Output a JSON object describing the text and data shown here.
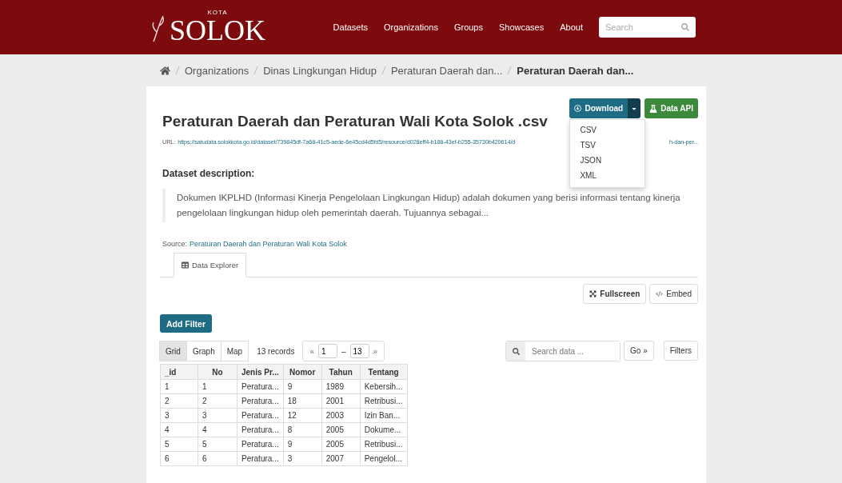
{
  "header": {
    "logo": {
      "small": "KOTA",
      "big": "SOLOK"
    },
    "nav": [
      "Datasets",
      "Organizations",
      "Groups",
      "Showcases",
      "About"
    ],
    "search": {
      "placeholder": "Search"
    }
  },
  "breadcrumb": {
    "items": [
      "Organizations",
      "Dinas Lingkungan Hidup",
      "Peraturan Daerah dan..."
    ],
    "current": "Peraturan Daerah dan..."
  },
  "resource": {
    "title": "Peraturan Daerah dan Peraturan Wali Kota Solok .csv",
    "download": {
      "label": "Download",
      "expanded": true,
      "options": [
        "CSV",
        "TSV",
        "JSON",
        "XML"
      ]
    },
    "data_api": "Data API",
    "url": {
      "label": "URL:",
      "start": "https://satudata.solokkota.go.id/dataset/739845df-7a68-41c5-aede-6e45cd4d5fd5/resource/d028eff4-b188-43ef-b255-35730b420614/d",
      "end": "h-dan-per..."
    },
    "description_heading": "Dataset description:",
    "description": "Dokumen IKPLHD (Informasi Kinerja Pengelolaan Lingkungan Hidup) adalah dokumen yang berisi informasi tentang kinerja pengelolaan lingkungan hidup oleh pemerintah daerah. Tujuannya sebagai...",
    "source": {
      "label": "Source:",
      "link": "Peraturan Daerah dan Peraturan Wali Kota Solok"
    }
  },
  "tabs": [
    {
      "label": "Data Explorer",
      "selected": true
    }
  ],
  "actions": [
    "Fullscreen",
    "Embed"
  ],
  "explorer": {
    "add_filter": "Add Filter",
    "views": [
      {
        "label": "Grid",
        "selected": true
      },
      {
        "label": "Graph",
        "selected": false
      },
      {
        "label": "Map",
        "selected": false
      }
    ],
    "records": "13 records",
    "prev": "«",
    "from": "1",
    "dash": "–",
    "to": "13",
    "next": "»",
    "search": {
      "placeholder": "Search data ..."
    },
    "go": "Go »",
    "filters": "Filters"
  },
  "table": {
    "columns": [
      "_id",
      "No",
      "Jenis Pr...",
      "Nomor",
      "Tahun",
      "Tentang"
    ],
    "rows": [
      [
        "1",
        "1",
        "Peratura...",
        "9",
        "1989",
        "Kebersih..."
      ],
      [
        "2",
        "2",
        "Peratura...",
        "18",
        "2001",
        "Retribusi..."
      ],
      [
        "3",
        "3",
        "Peratura...",
        "12",
        "2003",
        "Izin Ban..."
      ],
      [
        "4",
        "4",
        "Peratura...",
        "8",
        "2005",
        "Dokume..."
      ],
      [
        "5",
        "5",
        "Peratura...",
        "9",
        "2005",
        "Retribusi..."
      ],
      [
        "6",
        "6",
        "Peratura...",
        "3",
        "2007",
        "Pengelol..."
      ]
    ]
  }
}
